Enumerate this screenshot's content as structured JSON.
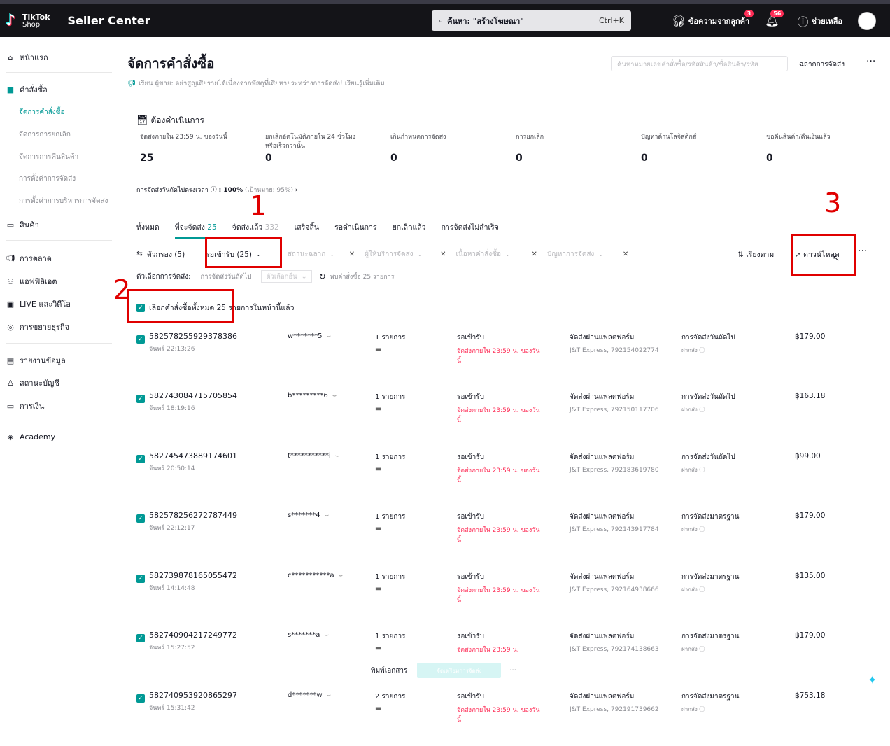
{
  "header": {
    "logo_line1": "TikTok",
    "logo_line2": "Shop",
    "app_title": "Seller Center",
    "search_placeholder": "ค้นหา: \"สร้างโฆษณา\"",
    "search_shortcut": "Ctrl+K",
    "messages_label": "ข้อความจากลูกค้า",
    "messages_badge": "3",
    "notifications_badge": "56",
    "help_label": "ช่วยเหลือ"
  },
  "sidebar": {
    "home": "หน้าแรก",
    "orders": "คำสั่งซื้อ",
    "orders_sub": [
      "จัดการคำสั่งซื้อ",
      "จัดการการยกเลิก",
      "จัดการการคืนสินค้า",
      "การตั้งค่าการจัดส่ง",
      "การตั้งค่าการบริหารการจัดส่ง"
    ],
    "products": "สินค้า",
    "marketing": "การตลาด",
    "affiliate": "แอฟฟิลิเอต",
    "live_video": "LIVE และวิดีโอ",
    "growth": "การขยายธุรกิจ",
    "data": "รายงานข้อมูล",
    "account_health": "สถานะบัญชี",
    "finance": "การเงิน",
    "academy": "Academy"
  },
  "page": {
    "title": "จัดการคำสั่งซื้อ",
    "notice": "เรียน ผู้ขาย: อย่าสูญเสียรายได้เนื่องจากพัสดุที่เสียหายระหว่างการจัดส่ง! เรียนรู้เพิ่มเติม",
    "search_placeholder": "ค้นหาหมายเลขคำสั่งซื้อ/รหัสสินค้า/ชื่อสินค้า/รหัส",
    "shipping_label_button": "ฉลากการจัดส่ง",
    "more": "···"
  },
  "todo": {
    "title": "ต้องดำเนินการ",
    "metrics": [
      {
        "label": "จัดส่งภายใน 23:59 น. ของวันนี้",
        "value": "25"
      },
      {
        "label": "ยกเลิกอัตโนมัติภายใน 24 ชั่วโมงหรือเร็วกว่านั้น",
        "value": "0"
      },
      {
        "label": "เกินกำหนดการจัดส่ง",
        "value": "0"
      },
      {
        "label": "การยกเลิก",
        "value": "0"
      },
      {
        "label": "ปัญหาด้านโลจิสติกส์",
        "value": "0"
      },
      {
        "label": "ขอคืนสินค้า/คืนเงินแล้ว",
        "value": "0"
      }
    ],
    "ontime_label": "การจัดส่งวันถัดไปตรงเวลา",
    "ontime_value": ": 100%",
    "ontime_target": "(เป้าหมาย: 95%)"
  },
  "tabs": [
    {
      "label": "ทั้งหมด",
      "count": ""
    },
    {
      "label": "ที่จะจัดส่ง",
      "count": "25"
    },
    {
      "label": "จัดส่งแล้ว",
      "count": "332"
    },
    {
      "label": "เสร็จสิ้น",
      "count": ""
    },
    {
      "label": "รอดำเนินการ",
      "count": ""
    },
    {
      "label": "ยกเลิกแล้ว",
      "count": ""
    },
    {
      "label": "การจัดส่งไม่สำเร็จ",
      "count": ""
    }
  ],
  "filters": {
    "filter_label": "ตัวกรอง (5)",
    "pending_pickup": "รอเข้ารับ (25)",
    "status_label": "สถานะฉลาก",
    "carrier": "ผู้ให้บริการจัดส่ง",
    "order_content": "เนื้อหาคำสั่งซื้อ",
    "shipping_issue": "ปัญหาการจัดส่ง",
    "sort": "เรียงตาม",
    "download": "ดาวน์โหลด",
    "ship_option_label": "ตัวเลือกการจัดส่ง:",
    "ship_option_value": "การจัดส่งวันถัดไป",
    "other_option": "ตัวเลือกอื่น",
    "found": "พบคำสั่งซื้อ 25 รายการ"
  },
  "select_all": "เลือกคำสั่งซื้อทั้งหมด 25 รายการในหน้านี้แล้ว",
  "orders": [
    {
      "id": "582578255929378386",
      "time": "จันทร์ 22:13:26",
      "buyer": "w*******5",
      "items": "1 รายการ",
      "status": "รอเข้ารับ",
      "deadline": "จัดส่งภายใน 23:59 น. ของวันนี้",
      "method": "จัดส่งผ่านแพลตฟอร์ม",
      "tracking": "J&T Express, 792154022774",
      "ship_type": "การจัดส่งวันถัดไป",
      "drop": "ฝากส่ง",
      "amount": "฿179.00"
    },
    {
      "id": "582743084715705854",
      "time": "จันทร์ 18:19:16",
      "buyer": "b*********6",
      "items": "1 รายการ",
      "status": "รอเข้ารับ",
      "deadline": "จัดส่งภายใน 23:59 น. ของวันนี้",
      "method": "จัดส่งผ่านแพลตฟอร์ม",
      "tracking": "J&T Express, 792150117706",
      "ship_type": "การจัดส่งวันถัดไป",
      "drop": "ฝากส่ง",
      "amount": "฿163.18"
    },
    {
      "id": "582745473889174601",
      "time": "จันทร์ 20:50:14",
      "buyer": "t***********i",
      "items": "1 รายการ",
      "status": "รอเข้ารับ",
      "deadline": "จัดส่งภายใน 23:59 น. ของวันนี้",
      "method": "จัดส่งผ่านแพลตฟอร์ม",
      "tracking": "J&T Express, 792183619780",
      "ship_type": "การจัดส่งวันถัดไป",
      "drop": "ฝากส่ง",
      "amount": "฿99.00"
    },
    {
      "id": "582578256272787449",
      "time": "จันทร์ 22:12:17",
      "buyer": "s*******4",
      "items": "1 รายการ",
      "status": "รอเข้ารับ",
      "deadline": "จัดส่งภายใน 23:59 น. ของวันนี้",
      "method": "จัดส่งผ่านแพลตฟอร์ม",
      "tracking": "J&T Express, 792143917784",
      "ship_type": "การจัดส่งมาตรฐาน",
      "drop": "ฝากส่ง",
      "amount": "฿179.00"
    },
    {
      "id": "582739878165055472",
      "time": "จันทร์ 14:14:48",
      "buyer": "c***********a",
      "items": "1 รายการ",
      "status": "รอเข้ารับ",
      "deadline": "จัดส่งภายใน 23:59 น. ของวันนี้",
      "method": "จัดส่งผ่านแพลตฟอร์ม",
      "tracking": "J&T Express, 792164938666",
      "ship_type": "การจัดส่งมาตรฐาน",
      "drop": "ฝากส่ง",
      "amount": "฿135.00"
    },
    {
      "id": "582740904217249772",
      "time": "จันทร์ 15:27:52",
      "buyer": "s*******a",
      "items": "1 รายการ",
      "status": "รอเข้ารับ",
      "deadline": "จัดส่งภายใน 23:59 น.",
      "method": "จัดส่งผ่านแพลตฟอร์ม",
      "tracking": "J&T Express, 792174138663",
      "ship_type": "การจัดส่งมาตรฐาน",
      "drop": "ฝากส่ง",
      "amount": "฿179.00"
    },
    {
      "id": "582740953920865297",
      "time": "จันทร์ 15:31:42",
      "buyer": "d*******w",
      "items": "2 รายการ",
      "status": "รอเข้ารับ",
      "deadline": "จัดส่งภายใน 23:59 น. ของวันนี้",
      "method": "จัดส่งผ่านแพลตฟอร์ม",
      "tracking": "J&T Express, 792191739662",
      "ship_type": "การจัดส่งมาตรฐาน",
      "drop": "ฝากส่ง",
      "amount": "฿753.18"
    }
  ],
  "floatbar": {
    "print_docs": "พิมพ์เอกสาร",
    "arrange": "จัดเตรียมการจัดส่ง",
    "more": "···"
  },
  "annotations": [
    "1",
    "2",
    "3"
  ],
  "colors": {
    "accent": "#009995",
    "alert": "#fe2c55",
    "annotation": "#e00000"
  }
}
